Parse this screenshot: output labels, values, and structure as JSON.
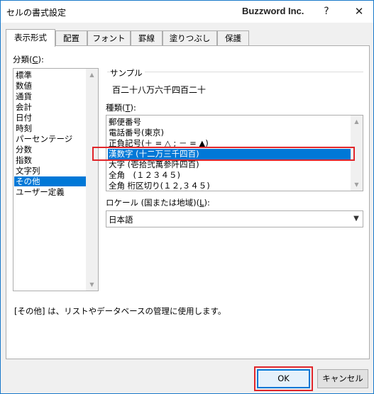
{
  "window": {
    "title": "セルの書式設定",
    "brand": "Buzzword Inc.",
    "help": "?",
    "close": "✕"
  },
  "tabs": [
    {
      "label": "表示形式",
      "active": true
    },
    {
      "label": "配置",
      "active": false
    },
    {
      "label": "フォント",
      "active": false
    },
    {
      "label": "罫線",
      "active": false
    },
    {
      "label": "塗りつぶし",
      "active": false
    },
    {
      "label": "保護",
      "active": false
    }
  ],
  "category": {
    "label_prefix": "分類(",
    "label_key": "C",
    "label_suffix": "):",
    "items": [
      "標準",
      "数値",
      "通貨",
      "会計",
      "日付",
      "時刻",
      "パーセンテージ",
      "分数",
      "指数",
      "文字列",
      "その他",
      "ユーザー定義"
    ],
    "selected": "その他"
  },
  "sample": {
    "caption": "サンプル",
    "value": "百二十八万六千四百二十"
  },
  "type": {
    "label_prefix": "種類(",
    "label_key": "T",
    "label_suffix": "):",
    "items": [
      "郵便番号",
      "電話番号(東京)",
      "正負記号(＋ = △ ; － = ▲)",
      "漢数字 (十二万三千四百)",
      "大字 (壱拾弐萬参阡四百)",
      "全角　(１２３４５)",
      "全角 桁区切り(１２,３４５)"
    ],
    "selected": "漢数字 (十二万三千四百)"
  },
  "locale": {
    "label_prefix": "ロケール (国または地域)(",
    "label_key": "L",
    "label_suffix": "):",
    "value": "日本語"
  },
  "description": "[その他] は、リストやデータベースの管理に使用します。",
  "buttons": {
    "ok": "OK",
    "cancel": "キャンセル"
  },
  "colors": {
    "accent": "#0078d7",
    "highlight_box": "#e0262b"
  }
}
